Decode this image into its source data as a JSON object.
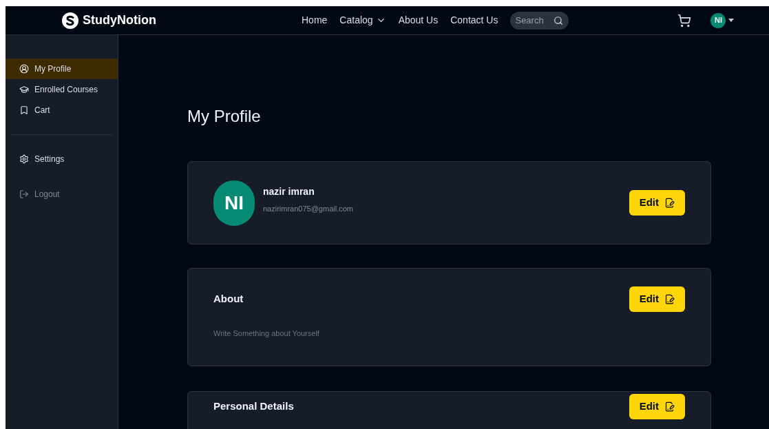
{
  "navbar": {
    "logo": "StudyNotion",
    "links": [
      {
        "label": "Home",
        "dropdown": false
      },
      {
        "label": "Catalog",
        "dropdown": true
      },
      {
        "label": "About Us",
        "dropdown": false
      },
      {
        "label": "Contact Us",
        "dropdown": false
      }
    ],
    "search": {
      "placeholder": "Search"
    },
    "avatar": "NI"
  },
  "sidebar": {
    "items": [
      {
        "label": "My Profile",
        "kind": "profile",
        "selected": true
      },
      {
        "label": "Enrolled Courses",
        "kind": "courses",
        "selected": false
      },
      {
        "label": "Cart",
        "kind": "cart",
        "selected": false
      }
    ],
    "bottom_items": [
      {
        "label": "Settings",
        "kind": "settings",
        "selected": false
      }
    ],
    "logout": {
      "label": "Logout"
    }
  },
  "main": {
    "title": "My Profile",
    "profile_card": {
      "avatar": "NI",
      "name": "nazir imran",
      "email": "nazirimran075@gmail.com",
      "button": "Edit"
    },
    "about_card": {
      "title": "About",
      "text": "Write Something about Yourself",
      "button": "Edit"
    },
    "details_card": {
      "title": "Personal Details",
      "button": "Edit"
    }
  }
}
